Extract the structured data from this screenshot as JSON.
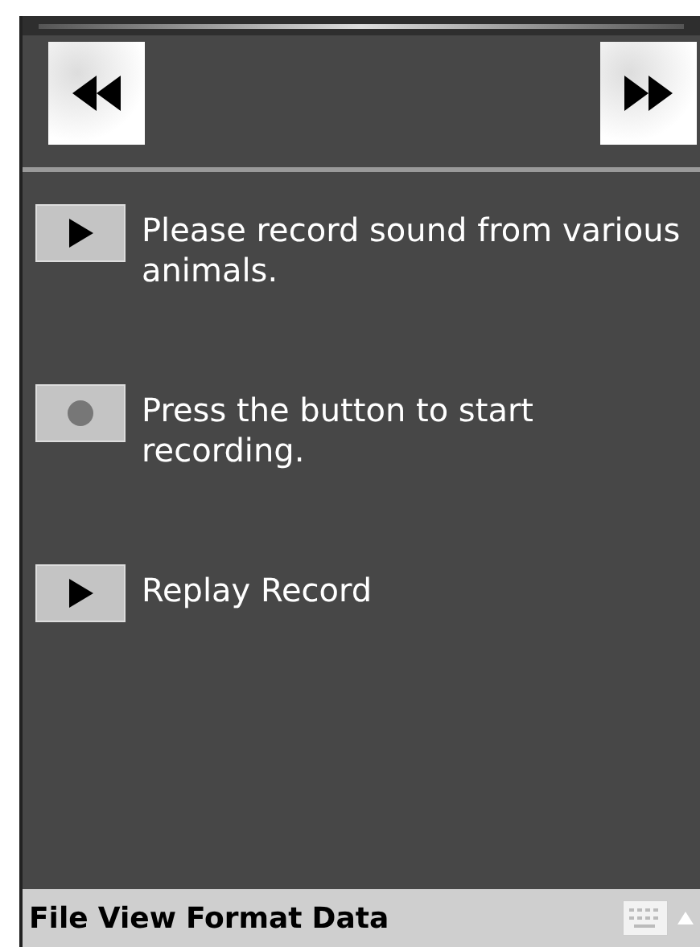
{
  "nav_buttons": [
    {
      "kind": "rewind"
    },
    {
      "kind": "fast-forward"
    }
  ],
  "items": [
    {
      "kind": "play",
      "text": "Please record sound from various animals."
    },
    {
      "kind": "record",
      "text": "Press the button to start recording."
    },
    {
      "kind": "play",
      "text": "Replay Record"
    }
  ],
  "menu_bar": {
    "items": [
      "File",
      "View",
      "Format",
      "Data"
    ]
  }
}
